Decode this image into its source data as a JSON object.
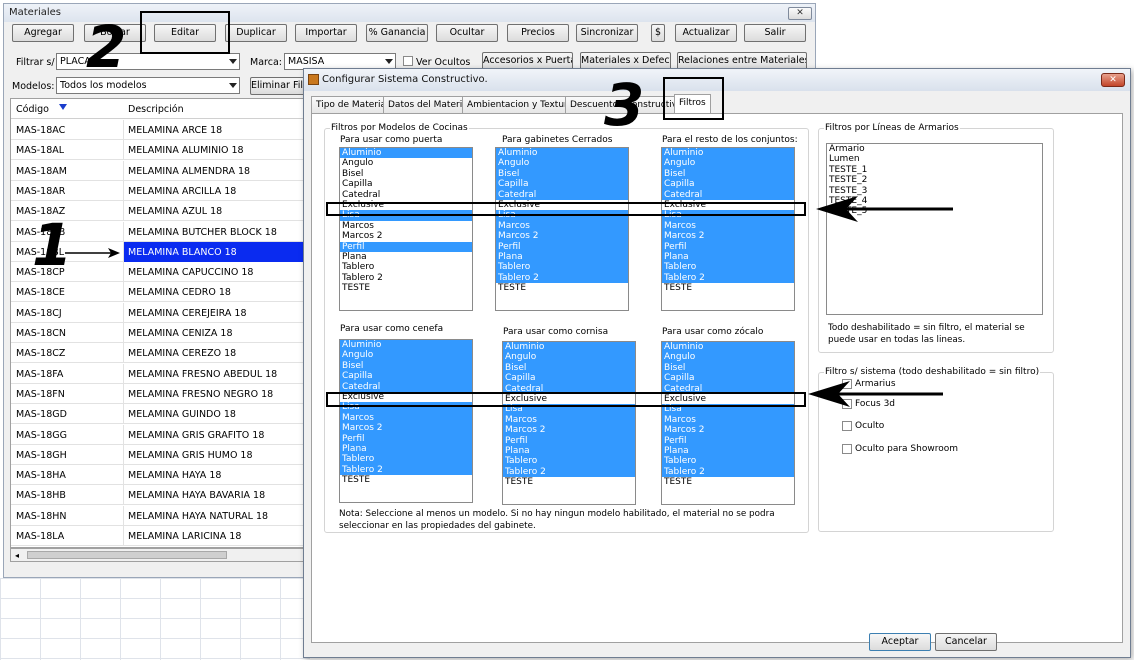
{
  "materials_window": {
    "title": "Materiales",
    "close_label": "✕",
    "buttons": [
      "Agregar",
      "Borrar",
      "Editar",
      "Duplicar",
      "Importar",
      "% Ganancia",
      "Ocultar",
      "Precios",
      "Sincronizar",
      "$",
      "Actualizar",
      "Salir"
    ],
    "filter_label": "Filtrar s/ :",
    "filter_value": "PLACA",
    "brand_label": "Marca:",
    "brand_value": "MASISA",
    "show_hidden_label": "Ver Ocultos",
    "accessories_button": "Accesorios x Puerta",
    "default_materials_button": "Materiales x Defecto",
    "relations_button": "Relaciones entre Materiales",
    "models_label": "Modelos:",
    "models_value": "Todos los modelos",
    "remove_filter_button": "Eliminar Filtro",
    "table": {
      "col_code": "Código",
      "col_desc": "Descripción",
      "rows": [
        {
          "code": "MAS-18AC",
          "desc": "MELAMINA ARCE 18"
        },
        {
          "code": "MAS-18AL",
          "desc": "MELAMINA ALUMINIO 18"
        },
        {
          "code": "MAS-18AM",
          "desc": "MELAMINA ALMENDRA 18"
        },
        {
          "code": "MAS-18AR",
          "desc": "MELAMINA ARCILLA 18"
        },
        {
          "code": "MAS-18AZ",
          "desc": "MELAMINA AZUL 18"
        },
        {
          "code": "MAS-18BB",
          "desc": "MELAMINA BUTCHER BLOCK 18"
        },
        {
          "code": "MAS-18BL",
          "desc": "MELAMINA BLANCO 18"
        },
        {
          "code": "MAS-18CP",
          "desc": "MELAMINA CAPUCCINO 18"
        },
        {
          "code": "MAS-18CE",
          "desc": "MELAMINA CEDRO 18"
        },
        {
          "code": "MAS-18CJ",
          "desc": "MELAMINA CEREJEIRA 18"
        },
        {
          "code": "MAS-18CN",
          "desc": "MELAMINA CENIZA 18"
        },
        {
          "code": "MAS-18CZ",
          "desc": "MELAMINA CEREZO 18"
        },
        {
          "code": "MAS-18FA",
          "desc": "MELAMINA FRESNO ABEDUL 18"
        },
        {
          "code": "MAS-18FN",
          "desc": "MELAMINA FRESNO NEGRO 18"
        },
        {
          "code": "MAS-18GD",
          "desc": "MELAMINA GUINDO 18"
        },
        {
          "code": "MAS-18GG",
          "desc": "MELAMINA GRIS GRAFITO 18"
        },
        {
          "code": "MAS-18GH",
          "desc": "MELAMINA GRIS HUMO 18"
        },
        {
          "code": "MAS-18HA",
          "desc": "MELAMINA HAYA 18"
        },
        {
          "code": "MAS-18HB",
          "desc": "MELAMINA HAYA BAVARIA 18"
        },
        {
          "code": "MAS-18HN",
          "desc": "MELAMINA HAYA NATURAL 18"
        },
        {
          "code": "MAS-18LA",
          "desc": "MELAMINA LARICINA 18"
        }
      ]
    }
  },
  "dialog": {
    "title": "Configurar Sistema Constructivo.",
    "close_label": "✕",
    "tabs": [
      "Tipo de Material",
      "Datos del Material",
      "Ambientacion y Texturas",
      "Descuentos Constructivos",
      "Filtros"
    ],
    "kitchen_group_title": "Filtros por Modelos de Cocinas",
    "lists": {
      "puerta": {
        "label": "Para usar como puerta",
        "items": [
          "Aluminio",
          "Angulo",
          "Bisel",
          "Capilla",
          "Catedral",
          "Exclusive",
          "Lisa",
          "Marcos",
          "Marcos 2",
          "Perfil",
          "Plana",
          "Tablero",
          "Tablero 2",
          "TESTE"
        ],
        "selected": [
          true,
          false,
          false,
          false,
          false,
          false,
          true,
          false,
          false,
          true,
          false,
          false,
          false,
          false
        ]
      },
      "cerrados": {
        "label": "Para gabinetes Cerrados",
        "items": [
          "Aluminio",
          "Angulo",
          "Bisel",
          "Capilla",
          "Catedral",
          "Exclusive",
          "Lisa",
          "Marcos",
          "Marcos 2",
          "Perfil",
          "Plana",
          "Tablero",
          "Tablero 2",
          "TESTE"
        ],
        "selected": [
          true,
          true,
          true,
          true,
          true,
          false,
          true,
          true,
          true,
          true,
          true,
          true,
          true,
          false
        ]
      },
      "resto": {
        "label": "Para el resto de los conjuntos:",
        "items": [
          "Aluminio",
          "Angulo",
          "Bisel",
          "Capilla",
          "Catedral",
          "Exclusive",
          "Lisa",
          "Marcos",
          "Marcos 2",
          "Perfil",
          "Plana",
          "Tablero",
          "Tablero 2",
          "TESTE"
        ],
        "selected": [
          true,
          true,
          true,
          true,
          true,
          false,
          true,
          true,
          true,
          true,
          true,
          true,
          true,
          false
        ]
      },
      "cenefa": {
        "label": "Para usar como cenefa",
        "items": [
          "Aluminio",
          "Angulo",
          "Bisel",
          "Capilla",
          "Catedral",
          "Exclusive",
          "Lisa",
          "Marcos",
          "Marcos 2",
          "Perfil",
          "Plana",
          "Tablero",
          "Tablero 2",
          "TESTE"
        ],
        "selected": [
          true,
          true,
          true,
          true,
          true,
          false,
          true,
          true,
          true,
          true,
          true,
          true,
          true,
          false
        ]
      },
      "cornisa": {
        "label": "Para usar como cornisa",
        "items": [
          "Aluminio",
          "Angulo",
          "Bisel",
          "Capilla",
          "Catedral",
          "Exclusive",
          "Lisa",
          "Marcos",
          "Marcos 2",
          "Perfil",
          "Plana",
          "Tablero",
          "Tablero 2",
          "TESTE"
        ],
        "selected": [
          true,
          true,
          true,
          true,
          true,
          false,
          true,
          true,
          true,
          true,
          true,
          true,
          true,
          false
        ]
      },
      "zocalo": {
        "label": "Para usar como zócalo",
        "items": [
          "Aluminio",
          "Angulo",
          "Bisel",
          "Capilla",
          "Catedral",
          "Exclusive",
          "Lisa",
          "Marcos",
          "Marcos 2",
          "Perfil",
          "Plana",
          "Tablero",
          "Tablero 2",
          "TESTE"
        ],
        "selected": [
          true,
          true,
          true,
          true,
          true,
          false,
          true,
          true,
          true,
          true,
          true,
          true,
          true,
          false
        ]
      }
    },
    "note": "Nota: Seleccione al menos un modelo. Si no hay ningun modelo habilitado, el material no se podra seleccionar en las propiedades del gabinete.",
    "wardrobe_group_title": "Filtros por Líneas de Armarios",
    "wardrobe_items": [
      "Armario",
      "Lumen",
      "TESTE_1",
      "TESTE_2",
      "TESTE_3",
      "TESTE_4",
      "TESTE_5"
    ],
    "wardrobe_note": "Todo deshabilitado = sin filtro, el material se puede usar en todas las lineas.",
    "system_group_title": "Filtro s/ sistema (todo deshabilitado = sin filtro)",
    "system_options": [
      "Armarius",
      "Focus 3d",
      "Oculto",
      "Oculto para Showroom"
    ],
    "accept_button": "Aceptar",
    "cancel_button": "Cancelar"
  },
  "annotations": {
    "step1": "1",
    "step2": "2",
    "step3": "3"
  }
}
